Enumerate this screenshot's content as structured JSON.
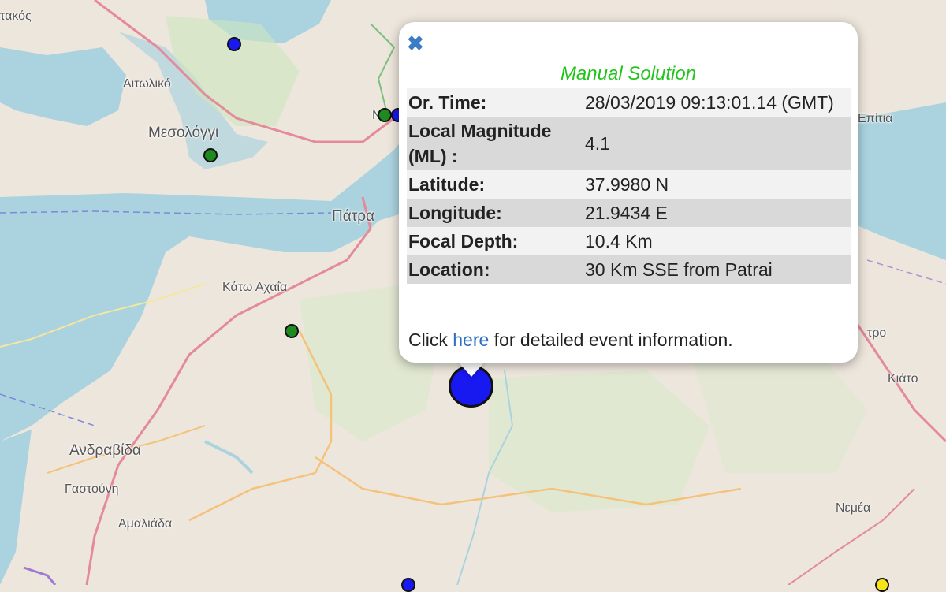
{
  "map": {
    "places": [
      {
        "name": "τακός"
      },
      {
        "name": "Αιτωλικό"
      },
      {
        "name": "Μεσολόγγι"
      },
      {
        "name": "Πάτρα"
      },
      {
        "name": "Κάτω Αχαΐα"
      },
      {
        "name": "Ανδραβίδα"
      },
      {
        "name": "Γαστούνη"
      },
      {
        "name": "Αμαλιάδα"
      },
      {
        "name": "Επίτια"
      },
      {
        "name": "τρο"
      },
      {
        "name": "Κιάτο"
      },
      {
        "name": "Νεμέα"
      },
      {
        "name": "Να"
      }
    ]
  },
  "popup": {
    "close_icon": "✖",
    "status": "Manual Solution",
    "rows": [
      {
        "label": "Or. Time:",
        "value": "28/03/2019 09:13:01.14 (GMT)"
      },
      {
        "label": "Local Magnitude (ML) :",
        "value": "4.1"
      },
      {
        "label": "Latitude:",
        "value": "37.9980 N"
      },
      {
        "label": "Longitude:",
        "value": "21.9434 E"
      },
      {
        "label": "Focal Depth:",
        "value": "10.4 Km"
      },
      {
        "label": "Location:",
        "value": "30 Km SSE from Patrai"
      }
    ],
    "footer_before": "Click",
    "footer_link": "here",
    "footer_after": "for detailed event information."
  },
  "colors": {
    "sea": "#abd3df",
    "land": "#ede6dc",
    "event_blue": "#1818f0",
    "event_green": "#1f8a1f",
    "event_yellow": "#f5e418",
    "status_green": "#22c41c",
    "link_blue": "#2a6fc2"
  }
}
